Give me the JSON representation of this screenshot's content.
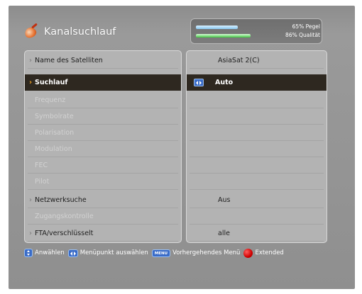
{
  "header": {
    "title": "Kanalsuchlauf",
    "icon": "satellite-dish-icon"
  },
  "signal": {
    "pegel_label": "65% Pegel",
    "qualitaet_label": "86% Qualität",
    "pegel_fraction": 0.65,
    "qualitaet_fraction": 0.86,
    "pegel_color": "#88c8f0",
    "qualitaet_color": "#40c040"
  },
  "menu": {
    "items": [
      {
        "label": "Name des Satelliten",
        "value": "AsiaSat 2(C)"
      },
      {
        "label": "Suchlauf",
        "value": "Auto"
      },
      {
        "label": "Frequenz",
        "value": ""
      },
      {
        "label": "Symbolrate",
        "value": ""
      },
      {
        "label": "Polarisation",
        "value": ""
      },
      {
        "label": "Modulation",
        "value": ""
      },
      {
        "label": "FEC",
        "value": ""
      },
      {
        "label": "Pilot",
        "value": ""
      },
      {
        "label": "Netzwerksuche",
        "value": "Aus"
      },
      {
        "label": "Zugangskontrolle",
        "value": ""
      },
      {
        "label": "FTA/verschlüsselt",
        "value": "alle"
      }
    ]
  },
  "footer": {
    "anwaehlen": "Anwählen",
    "menupunkt": "Menüpunkt auswählen",
    "menu_key": "MENU",
    "vorhergehend": "Vorhergehendes Menü",
    "extended": "Extended"
  },
  "colors": {
    "selected_row": "#2e2820",
    "accent": "#f0a020"
  }
}
